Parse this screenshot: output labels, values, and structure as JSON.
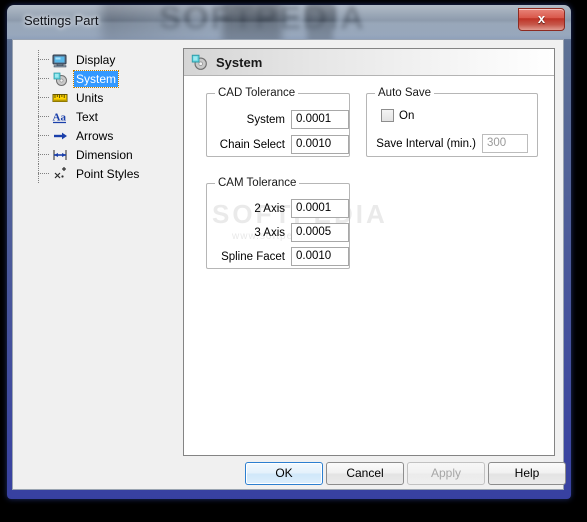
{
  "window": {
    "title": "Settings Part",
    "close_label": "x",
    "watermark": "SOFTPEDIA"
  },
  "sidebar": {
    "items": [
      {
        "label": "Display",
        "icon": "monitor-icon",
        "selected": false
      },
      {
        "label": "System",
        "icon": "system-disc-icon",
        "selected": true
      },
      {
        "label": "Units",
        "icon": "ruler-icon",
        "selected": false
      },
      {
        "label": "Text",
        "icon": "text-aa-icon",
        "selected": false
      },
      {
        "label": "Arrows",
        "icon": "arrow-icon",
        "selected": false
      },
      {
        "label": "Dimension",
        "icon": "dimension-icon",
        "selected": false
      },
      {
        "label": "Point Styles",
        "icon": "point-styles-icon",
        "selected": false
      }
    ]
  },
  "panel": {
    "header_title": "System",
    "header_icon": "system-disc-icon",
    "watermark": "SOFTPEDIA",
    "watermark_sub": "www.softpedia.com",
    "cad_tolerance": {
      "title": "CAD Tolerance",
      "fields": [
        {
          "label": "System",
          "value": "0.0001"
        },
        {
          "label": "Chain Select",
          "value": "0.0010"
        }
      ]
    },
    "auto_save": {
      "title": "Auto Save",
      "checkbox_label": "On",
      "checkbox_checked": false,
      "interval_label": "Save Interval (min.)",
      "interval_value": "300",
      "interval_enabled": false
    },
    "cam_tolerance": {
      "title": "CAM Tolerance",
      "fields": [
        {
          "label": "2 Axis",
          "value": "0.0001"
        },
        {
          "label": "3 Axis",
          "value": "0.0005"
        },
        {
          "label": "Spline Facet",
          "value": "0.0010"
        }
      ]
    }
  },
  "buttons": {
    "ok": "OK",
    "cancel": "Cancel",
    "apply": "Apply",
    "help": "Help"
  },
  "colors": {
    "selection_blue": "#3399ff",
    "frame_blue": "#3c46af",
    "close_red": "#bf3326",
    "panel_bg": "#ffffff",
    "dialog_bg": "#f0f0f0"
  }
}
